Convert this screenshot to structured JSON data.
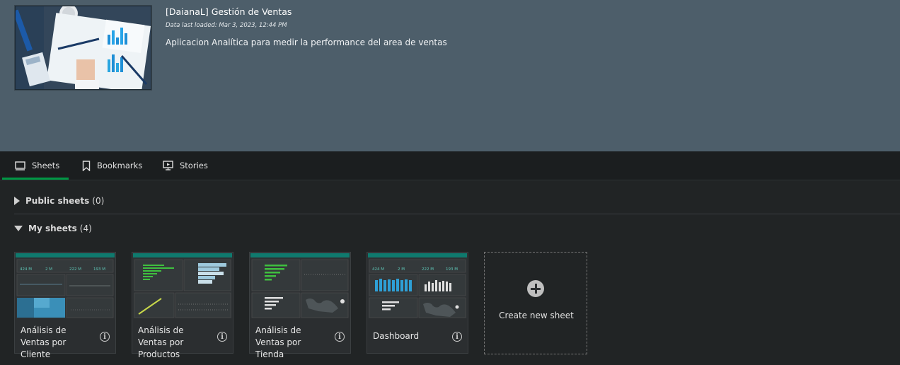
{
  "app": {
    "title": "[DaianaL] Gestión de Ventas",
    "data_loaded": "Data last loaded: Mar 3, 2023, 12:44 PM",
    "description": "Aplicacion Analítica para medir la performance del area de ventas"
  },
  "tabs": [
    {
      "label": "Sheets",
      "icon": "sheet-icon",
      "active": true
    },
    {
      "label": "Bookmarks",
      "icon": "bookmark-icon",
      "active": false
    },
    {
      "label": "Stories",
      "icon": "stories-icon",
      "active": false
    }
  ],
  "sections": {
    "public": {
      "label": "Public sheets",
      "count": "(0)"
    },
    "mine": {
      "label": "My sheets",
      "count": "(4)"
    }
  },
  "sheets": [
    {
      "label": "Análisis de Ventas por Cliente"
    },
    {
      "label": "Análisis de Ventas por Productos"
    },
    {
      "label": "Análisis de Ventas por Tienda"
    },
    {
      "label": "Dashboard"
    }
  ],
  "create_new": {
    "label": "Create new sheet"
  },
  "thumbnail_kpis": {
    "cliente": [
      "424 M",
      "2 M",
      "222 M",
      "193 M"
    ],
    "dashboard": [
      "424 M",
      "2 M",
      "222 M",
      "193 M"
    ]
  },
  "colors": {
    "accent": "#009845",
    "header_bg": "#4d5e6a",
    "page_bg": "#212425"
  }
}
